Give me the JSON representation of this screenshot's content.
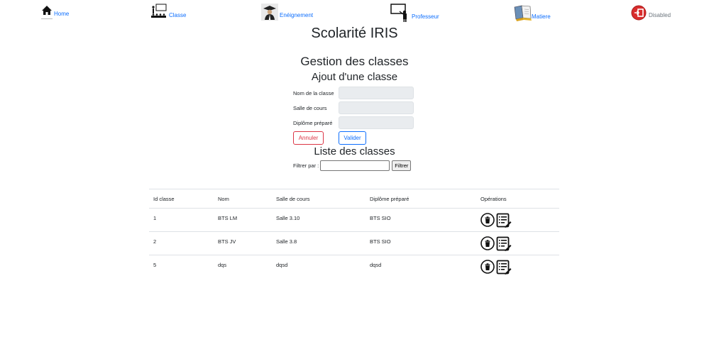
{
  "nav": {
    "home": "Home",
    "classe": "Classe",
    "enseignement": "Enéignement",
    "professeur": "Professeur",
    "matiere": "Matiere",
    "disabled": "Disabled"
  },
  "page_title": "Scolarité IRIS",
  "section_title": "Gestion des classes",
  "form": {
    "title": "Ajout d'une classe",
    "nom_label": "Nom de la classe",
    "salle_label": "Salle de cours",
    "diplome_label": "Diplôme préparé",
    "nom_value": "",
    "salle_value": "",
    "diplome_value": "",
    "cancel_label": "Annuler",
    "submit_label": "Valider"
  },
  "list": {
    "title": "Liste des classes",
    "filter_label": "Filtrer par :",
    "filter_value": "",
    "filter_button": "Filtrer"
  },
  "table": {
    "headers": [
      "Id classe",
      "Nom",
      "Salle de cours",
      "Diplôme préparé",
      "Opérations"
    ],
    "rows": [
      [
        "1",
        "BTS LM",
        "Salle 3.10",
        "BTS SIO"
      ],
      [
        "2",
        "BTS JV",
        "Salle 3.8",
        "BTS SIO"
      ],
      [
        "5",
        "dqs",
        "dqsd",
        "dqsd"
      ]
    ]
  },
  "icons": {
    "home": "home-icon",
    "classe": "classroom-icon",
    "enseignement": "graduate-icon",
    "professeur": "teacher-board-icon",
    "matiere": "book-icon",
    "disabled": "exit-icon",
    "delete": "trash-icon",
    "edit": "edit-list-icon"
  },
  "colors": {
    "link": "#0d6efd",
    "cancel": "#dc3545",
    "disabled": "#6c757d",
    "exit_icon": "#d92d2d"
  }
}
